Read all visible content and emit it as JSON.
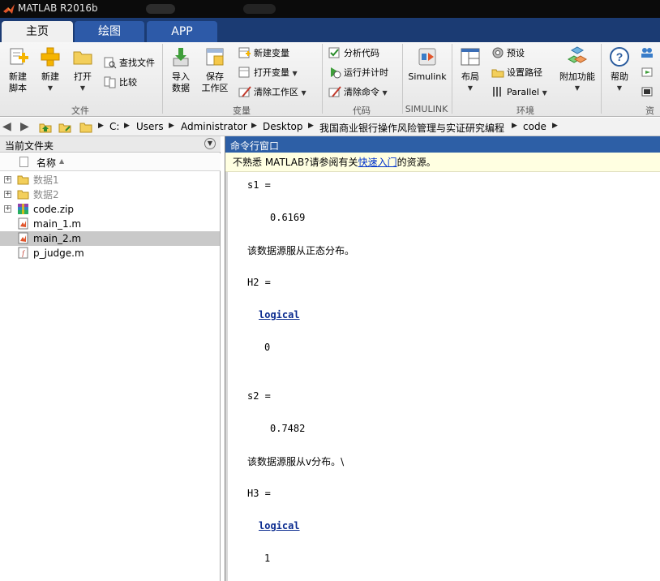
{
  "window": {
    "title": "MATLAB R2016b"
  },
  "tabs": [
    {
      "label": "主页",
      "active": true
    },
    {
      "label": "绘图",
      "active": false
    },
    {
      "label": "APP",
      "active": false
    }
  ],
  "ribbon": {
    "file": {
      "group_label": "文件",
      "new_script": "新建\n脚本",
      "new": "新建",
      "open": "打开",
      "find_files": "查找文件",
      "compare": "比较"
    },
    "variable": {
      "group_label": "变量",
      "import_data": "导入\n数据",
      "save_workspace": "保存\n工作区",
      "new_variable": "新建变量",
      "open_variable": "打开变量",
      "clear_workspace": "清除工作区"
    },
    "code": {
      "group_label": "代码",
      "analyze_code": "分析代码",
      "run_and_time": "运行并计时",
      "clear_commands": "清除命令"
    },
    "simulink": {
      "group_label": "SIMULINK",
      "simulink": "Simulink"
    },
    "environment": {
      "group_label": "环境",
      "layout": "布局",
      "preferences": "预设",
      "set_path": "设置路径",
      "parallel": "Parallel",
      "addons": "附加功能"
    },
    "resources": {
      "group_label": "资",
      "help": "帮助"
    }
  },
  "address": {
    "crumbs": [
      "C:",
      "Users",
      "Administrator",
      "Desktop",
      "我国商业银行操作风险管理与实证研究编程",
      "code"
    ]
  },
  "current_folder": {
    "title": "当前文件夹",
    "column_name": "名称",
    "items": [
      {
        "name": "数据1",
        "type": "folder",
        "expandable": true,
        "selected": false
      },
      {
        "name": "数据2",
        "type": "folder",
        "expandable": true,
        "selected": false
      },
      {
        "name": "code.zip",
        "type": "zip",
        "expandable": true,
        "selected": false
      },
      {
        "name": "main_1.m",
        "type": "mfile",
        "expandable": false,
        "selected": false
      },
      {
        "name": "main_2.m",
        "type": "mfile",
        "expandable": false,
        "selected": true
      },
      {
        "name": "p_judge.m",
        "type": "mfunc",
        "expandable": false,
        "selected": false
      }
    ]
  },
  "command_window": {
    "title": "命令行窗口",
    "tip_prefix": "不熟悉 MATLAB?请参阅有关",
    "tip_link": "快速入门",
    "tip_suffix": "的资源。",
    "lines": [
      "s1 =",
      "0.6169",
      "该数据源服从正态分布。",
      "H2 =",
      "logical",
      "0",
      "s2 =",
      "0.7482",
      "该数据源服从v分布。\\",
      "H3 =",
      "logical",
      "1"
    ]
  }
}
